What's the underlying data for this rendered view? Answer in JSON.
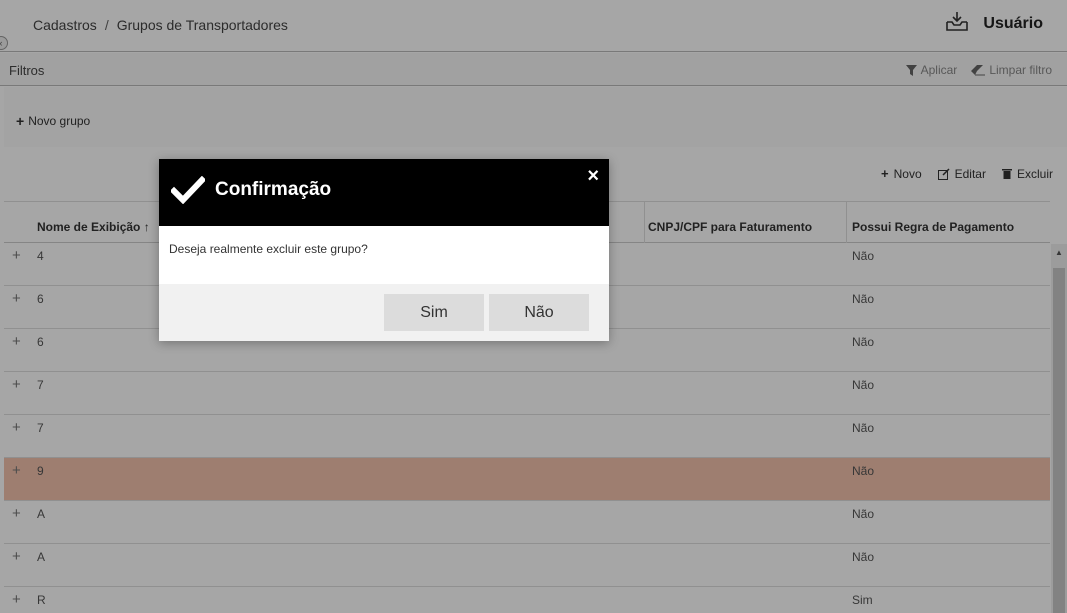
{
  "breadcrumb": {
    "section": "Cadastros",
    "separator": "/",
    "page": "Grupos de Transportadores"
  },
  "user": {
    "name": "Usuário"
  },
  "filters": {
    "label": "Filtros",
    "apply": "Aplicar",
    "clear": "Limpar filtro"
  },
  "toolbar": {
    "new_group": "Novo grupo"
  },
  "grid_actions": {
    "new": "Novo",
    "edit": "Editar",
    "delete": "Excluir"
  },
  "table": {
    "columns": [
      "Nome de Exibição ↑",
      "CNPJ/CPF para Faturamento",
      "Possui Regra de Pagamento"
    ],
    "rows": [
      {
        "name": "4",
        "payment_rule": "Não"
      },
      {
        "name": "6",
        "payment_rule": "Não"
      },
      {
        "name": "6",
        "payment_rule": "Não"
      },
      {
        "name": "7",
        "payment_rule": "Não"
      },
      {
        "name": "7",
        "payment_rule": "Não"
      },
      {
        "name": "9",
        "payment_rule": "Não"
      },
      {
        "name": "A",
        "payment_rule": "Não"
      },
      {
        "name": "A",
        "payment_rule": "Não"
      },
      {
        "name": "R",
        "payment_rule": "Sim"
      }
    ]
  },
  "modal": {
    "title": "Confirmação",
    "close": "×",
    "message": "Deseja realmente excluir este grupo?",
    "yes": "Sim",
    "no": "Não"
  },
  "colors": {
    "highlight_row": "#f3c2ad",
    "modal_header": "#000000",
    "button": "#dcdcdc"
  }
}
